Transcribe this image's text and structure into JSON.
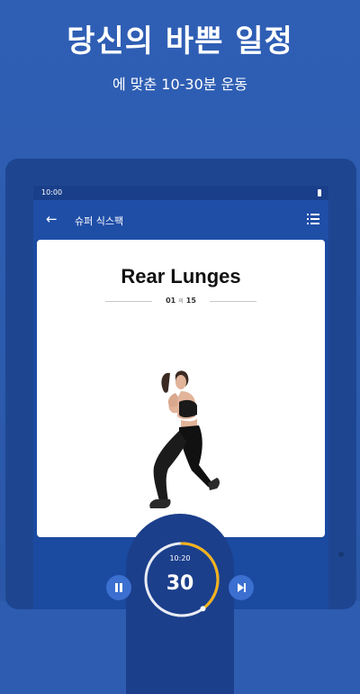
{
  "promo": {
    "headline": "당신의 바쁜 일정",
    "subline": "에 맞춘 10-30분 운동"
  },
  "statusbar": {
    "time": "10:00"
  },
  "appbar": {
    "title": "슈퍼 식스팩",
    "icons": [
      "back-arrow-icon",
      "list-icon"
    ]
  },
  "exercise": {
    "name": "Rear Lunges",
    "current": "01",
    "of_word": "의",
    "total": "15"
  },
  "timer": {
    "total": "10:20",
    "remaining": "30",
    "progress_fraction": 0.4
  },
  "controls": {
    "icons": [
      "pause-icon",
      "skip-next-icon"
    ]
  },
  "colors": {
    "background": "#2d5cb1",
    "accent_timer": "#f6b21a",
    "button": "#3b6fd0"
  }
}
